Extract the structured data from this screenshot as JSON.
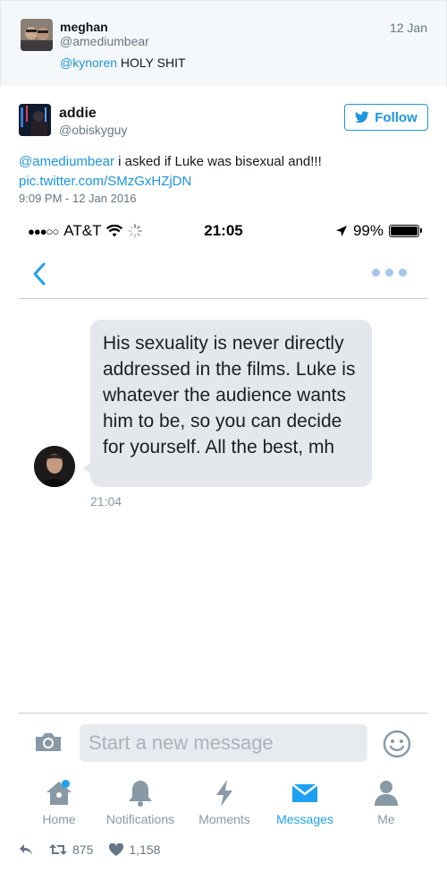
{
  "parent_tweet": {
    "name": "meghan",
    "handle": "@amediumbear",
    "date": "12 Jan",
    "mention": "@kynoren",
    "text": "HOLY SHIT"
  },
  "tweet": {
    "name": "addie",
    "handle": "@obiskyguy",
    "follow_label": "Follow",
    "mention": "@amediumbear",
    "text": "i asked if Luke was bisexual and!!!",
    "link": "pic.twitter.com/SMzGxHZjDN",
    "timestamp": "9:09 PM - 12 Jan 2016",
    "retweets": "875",
    "likes": "1,158"
  },
  "phone": {
    "status": {
      "signal": "●●●○○",
      "carrier": "AT&T",
      "time": "21:05",
      "battery": "99%"
    },
    "message": {
      "text": "His sexuality is never directly addressed in the films. Luke is whatever the audience wants him to be, so you can decide for yourself. All the best, mh",
      "time": "21:04"
    },
    "composer": {
      "placeholder": "Start a new message"
    },
    "tabs": [
      {
        "label": "Home",
        "icon": "home-icon"
      },
      {
        "label": "Notifications",
        "icon": "bell-icon"
      },
      {
        "label": "Moments",
        "icon": "lightning-icon"
      },
      {
        "label": "Messages",
        "icon": "envelope-icon"
      },
      {
        "label": "Me",
        "icon": "person-icon"
      }
    ],
    "active_tab": "Messages",
    "accent_color": "#1da1f2"
  }
}
